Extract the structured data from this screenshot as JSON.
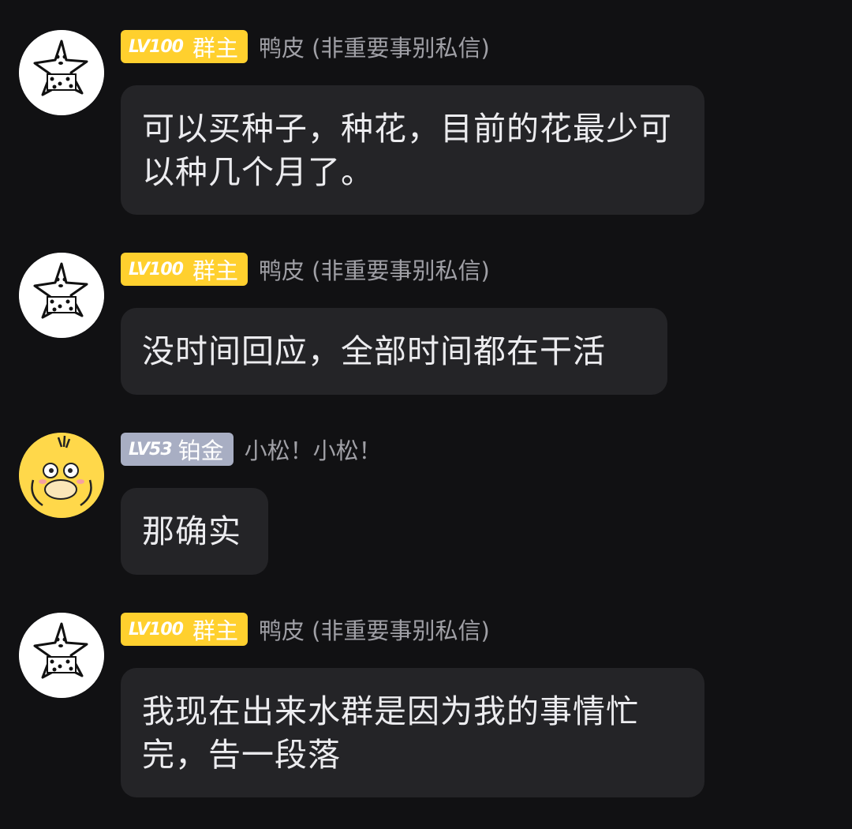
{
  "messages": [
    {
      "avatar": "starfish-avatar",
      "level": "LV100",
      "role": "群主",
      "role_color": "#ffd02e",
      "nickname": "鸭皮 (非重要事别私信)",
      "text": "可以买种子，种花，目前的花最少可以种几个月了。"
    },
    {
      "avatar": "starfish-avatar",
      "level": "LV100",
      "role": "群主",
      "role_color": "#ffd02e",
      "nickname": "鸭皮 (非重要事别私信)",
      "text": "没时间回应，全部时间都在干活"
    },
    {
      "avatar": "psyduck-avatar",
      "level": "LV53",
      "role": "铂金",
      "role_color": "#a8aec3",
      "nickname": "小松！小松！",
      "text": "那确实"
    },
    {
      "avatar": "starfish-avatar",
      "level": "LV100",
      "role": "群主",
      "role_color": "#ffd02e",
      "nickname": "鸭皮 (非重要事别私信)",
      "text": "我现在出来水群是因为我的事情忙完，告一段落"
    }
  ]
}
